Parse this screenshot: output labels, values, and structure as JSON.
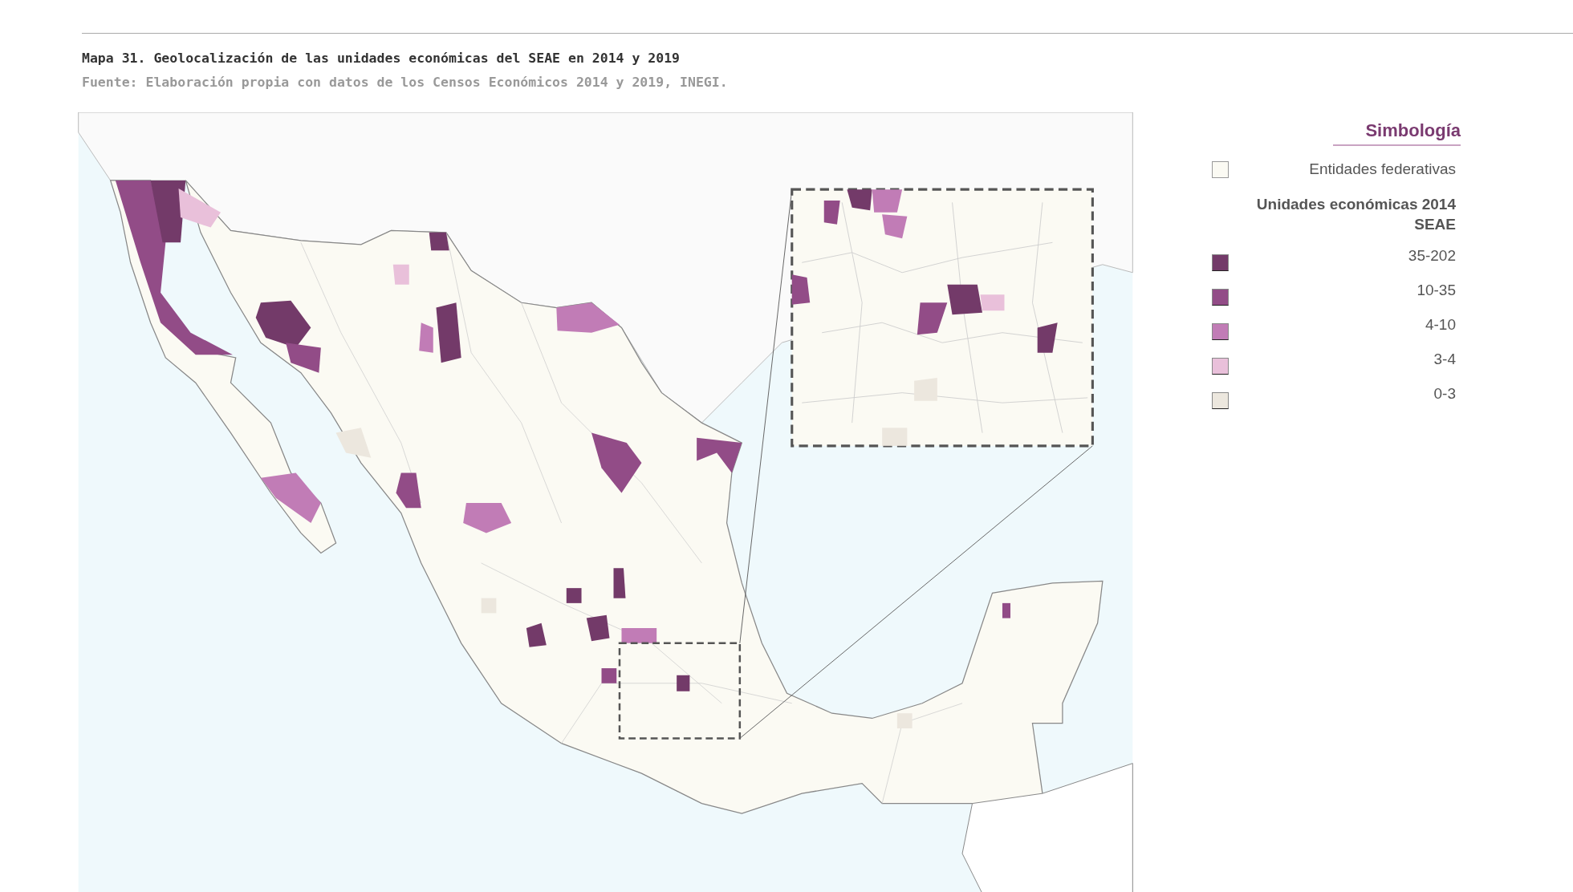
{
  "caption": {
    "title": "Mapa 31. Geolocalización de las unidades económicas del SEAE en 2014 y 2019",
    "source": "Fuente: Elaboración propia con datos de los Censos Económicos 2014 y 2019, INEGI."
  },
  "legend": {
    "title": "Simbología",
    "boundary": {
      "label": "Entidades federativas",
      "color": "#fbfaf3"
    },
    "heading": "Unidades económicas 2014 SEAE",
    "items": [
      {
        "label": "35-202",
        "color": "#733a69"
      },
      {
        "label": "10-35",
        "color": "#924c87"
      },
      {
        "label": "4-10",
        "color": "#c17cb6"
      },
      {
        "label": "3-4",
        "color": "#e9c0da"
      },
      {
        "label": "0-3",
        "color": "#ece7de"
      }
    ]
  }
}
